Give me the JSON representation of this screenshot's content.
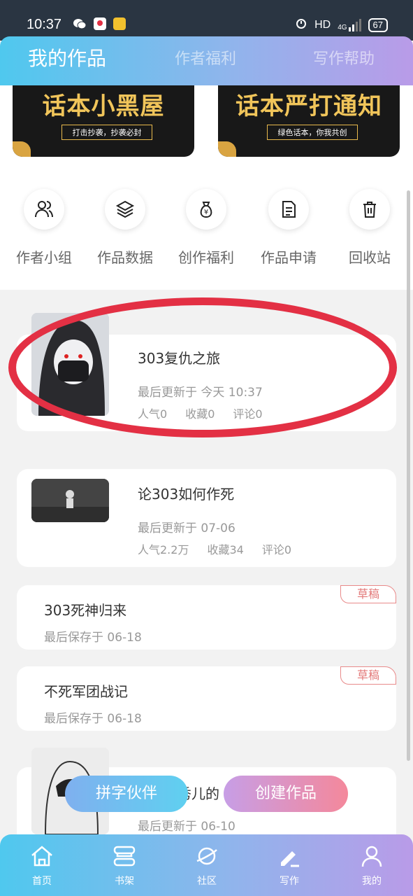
{
  "status_bar": {
    "time": "10:37",
    "network": "HD",
    "signal": "4G",
    "battery": "67"
  },
  "header": {
    "tabs": [
      {
        "label": "我的作品",
        "active": true
      },
      {
        "label": "作者福利"
      },
      {
        "label": "写作帮助"
      }
    ]
  },
  "banners": [
    {
      "title": "话本小黑屋",
      "subtitle": "打击抄袭，抄袭必封"
    },
    {
      "title": "话本严打通知",
      "subtitle": "绿色话本，你我共创"
    }
  ],
  "quick_actions": [
    {
      "label": "作者小组",
      "icon": "users-icon"
    },
    {
      "label": "作品数据",
      "icon": "layers-icon"
    },
    {
      "label": "创作福利",
      "icon": "money-bag-icon"
    },
    {
      "label": "作品申请",
      "icon": "document-icon"
    },
    {
      "label": "回收站",
      "icon": "trash-icon"
    }
  ],
  "works": [
    {
      "title": "303复仇之旅",
      "meta": "最后更新于 今天 10:37",
      "stats": {
        "popularity": "人气0",
        "favorites": "收藏0",
        "comments": "评论0"
      }
    },
    {
      "title": "论303如何作死",
      "meta": "最后更新于 07-06",
      "stats": {
        "popularity": "人气2.2万",
        "favorites": "收藏34",
        "comments": "评论0"
      }
    },
    {
      "title": "303死神归来",
      "meta": "最后保存于 06-18",
      "badge": "草稿"
    },
    {
      "title": "不死军团战记",
      "meta": "最后保存于 06-18",
      "badge": "草稿"
    },
    {
      "title_partial": "秀儿的",
      "meta": "最后更新于 06-10"
    }
  ],
  "floating_buttons": {
    "partner": "拼字伙伴",
    "create": "创建作品"
  },
  "bottom_nav": [
    {
      "label": "首页",
      "icon": "home-icon"
    },
    {
      "label": "书架",
      "icon": "bookshelf-icon"
    },
    {
      "label": "社区",
      "icon": "planet-icon"
    },
    {
      "label": "写作",
      "icon": "pen-icon",
      "active": true
    },
    {
      "label": "我的",
      "icon": "profile-icon"
    }
  ],
  "colors": {
    "accent_start": "#4fc8ee",
    "accent_end": "#b99be8",
    "annotation": "#e33044",
    "draft": "#e37a7a"
  }
}
